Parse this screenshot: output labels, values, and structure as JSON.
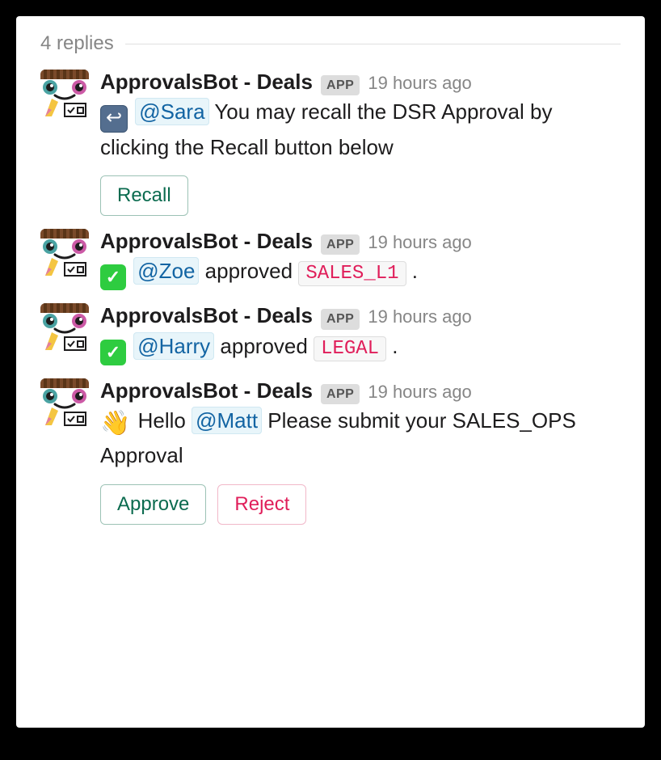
{
  "thread": {
    "replies_label": "4 replies"
  },
  "labels": {
    "app_badge": "APP"
  },
  "messages": [
    {
      "sender": "ApprovalsBot - Deals",
      "time": "19 hours ago",
      "emoji": "leftback",
      "parts": [
        {
          "type": "mention",
          "text": "@Sara"
        },
        {
          "type": "text",
          "text": " You may recall the DSR Approval by clicking the Recall button below"
        }
      ],
      "buttons": [
        {
          "label": "Recall",
          "style": "green"
        }
      ]
    },
    {
      "sender": "ApprovalsBot - Deals",
      "time": "19 hours ago",
      "emoji": "checkmark",
      "parts": [
        {
          "type": "text",
          "text": "  "
        },
        {
          "type": "mention",
          "text": "@Zoe"
        },
        {
          "type": "text",
          "text": " approved "
        },
        {
          "type": "code",
          "text": "SALES_L1"
        },
        {
          "type": "text",
          "text": " ."
        }
      ],
      "buttons": []
    },
    {
      "sender": "ApprovalsBot - Deals",
      "time": "19 hours ago",
      "emoji": "checkmark",
      "parts": [
        {
          "type": "text",
          "text": "  "
        },
        {
          "type": "mention",
          "text": "@Harry"
        },
        {
          "type": "text",
          "text": " approved "
        },
        {
          "type": "code",
          "text": "LEGAL"
        },
        {
          "type": "text",
          "text": " ."
        }
      ],
      "buttons": []
    },
    {
      "sender": "ApprovalsBot - Deals",
      "time": "19 hours ago",
      "emoji": "wave",
      "parts": [
        {
          "type": "text",
          "text": " Hello "
        },
        {
          "type": "mention",
          "text": "@Matt"
        },
        {
          "type": "text",
          "text": " Please submit your SALES_OPS Approval"
        }
      ],
      "buttons": [
        {
          "label": "Approve",
          "style": "green"
        },
        {
          "label": "Reject",
          "style": "red"
        }
      ]
    }
  ]
}
